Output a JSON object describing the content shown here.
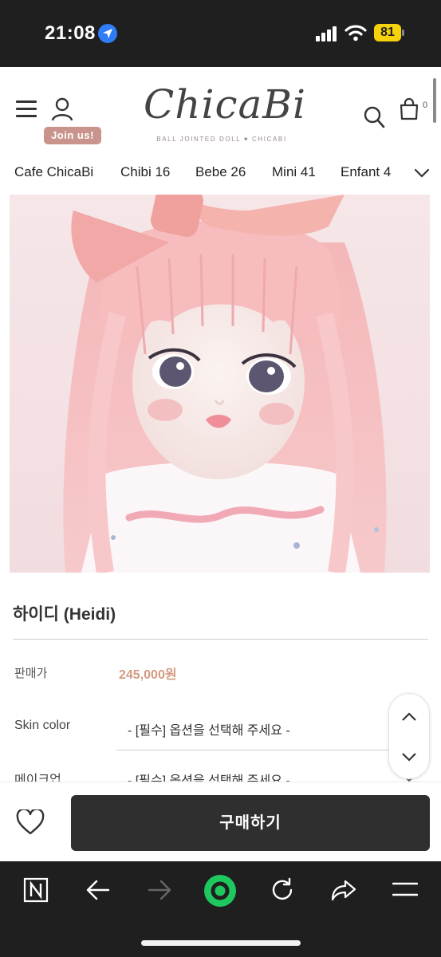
{
  "status_bar": {
    "time": "21:08",
    "battery": "81",
    "icons": [
      "location-arrow-icon",
      "signal-icon",
      "wifi-icon",
      "battery-icon"
    ]
  },
  "header": {
    "logo_text": "ChicaBi",
    "logo_subtitle": "BALL JOINTED DOLL ♥ CHICABI",
    "join_label": "Join us!",
    "cart_count": "0",
    "icons": [
      "menu-icon",
      "user-icon",
      "search-icon",
      "cart-icon"
    ]
  },
  "nav": {
    "items": [
      "Cafe ChicaBi",
      "Chibi 16",
      "Bebe 26",
      "Mini 41",
      "Enfant 4"
    ]
  },
  "product": {
    "image_alt": "Doll with long pink hair and a pink bow",
    "title": "하이디 (Heidi)",
    "price_label": "판매가",
    "price": "245,000원",
    "options": [
      {
        "label": "Skin color",
        "value": "- [필수] 옵션을 선택해 주세요 -"
      },
      {
        "label": "메이크업",
        "value": "- [필수] 옵션을 선택해 주세요 -"
      }
    ]
  },
  "actions": {
    "buy_label": "구매하기"
  },
  "browser_toolbar": {
    "icons": [
      "naver-icon",
      "back-arrow-icon",
      "forward-arrow-icon",
      "green-home-icon",
      "refresh-icon",
      "share-icon",
      "menu-lines-icon"
    ]
  },
  "colors": {
    "accent_price": "#d49a80",
    "join_badge": "#c9948c",
    "buy_button": "#2f2f2f",
    "battery": "#f5d20a",
    "green_home": "#1ec85e"
  }
}
